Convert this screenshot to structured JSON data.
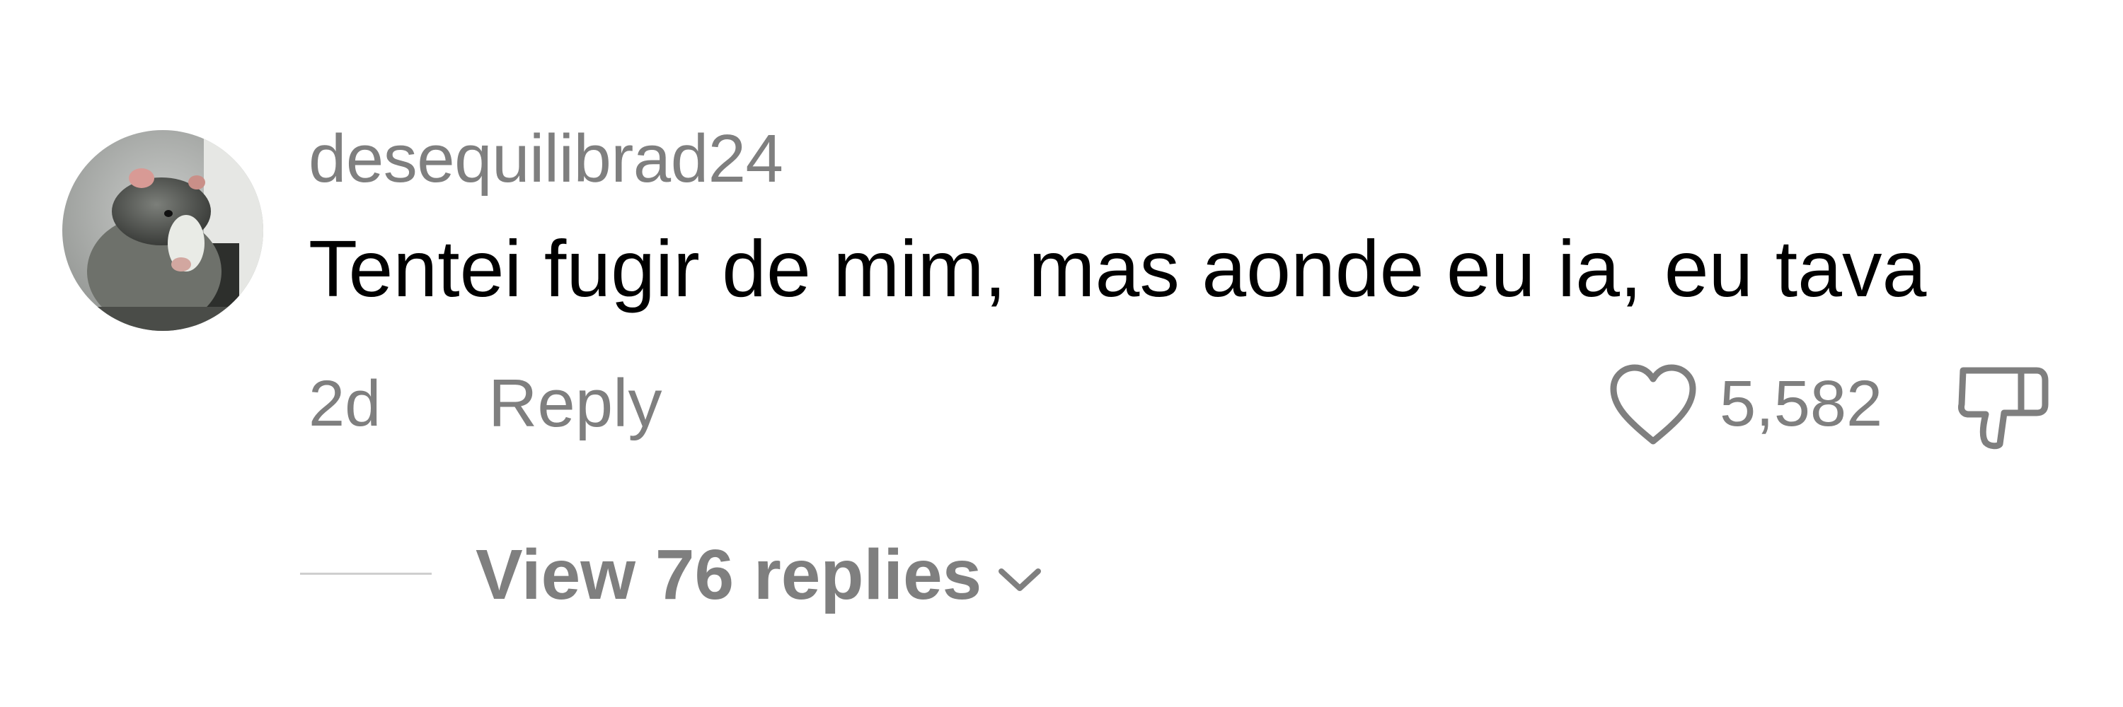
{
  "comment": {
    "username": "desequilibrad24",
    "text": "Tentei fugir de mim, mas aonde eu ia, eu tava",
    "timestamp": "2d",
    "reply_label": "Reply",
    "like_count": "5,582",
    "view_replies_label": "View 76 replies",
    "icons": {
      "avatar": "avatar-rat-photo",
      "like": "heart-outline-icon",
      "dislike": "thumbs-down-outline-icon",
      "expand": "chevron-down-icon"
    },
    "colors": {
      "secondary_text": "#7f7f7f",
      "primary_text": "#000000",
      "divider": "#cfcfcf"
    }
  }
}
